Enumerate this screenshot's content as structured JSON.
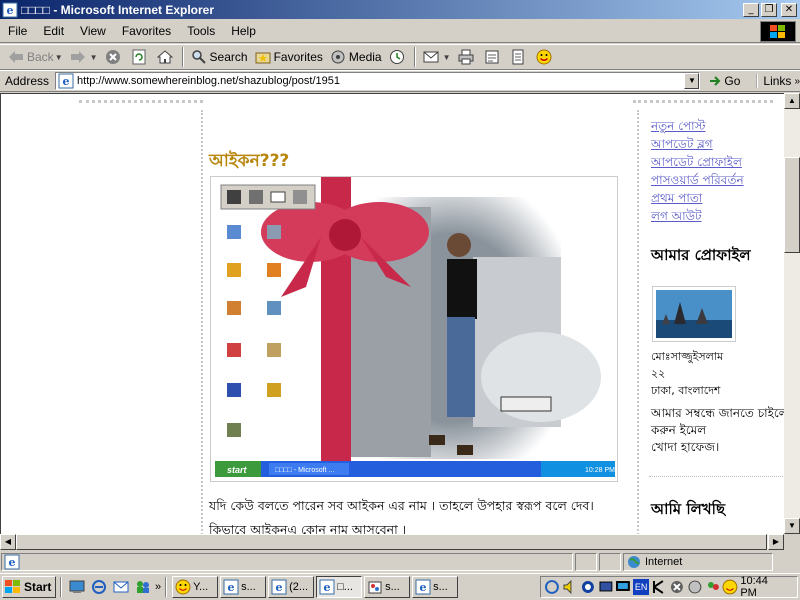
{
  "window": {
    "title": "□□□□ - Microsoft Internet Explorer",
    "minimize": "_",
    "maximize": "❐",
    "close": "✕"
  },
  "menu": [
    "File",
    "Edit",
    "View",
    "Favorites",
    "Tools",
    "Help"
  ],
  "toolbar": {
    "back": "Back",
    "search": "Search",
    "favorites": "Favorites",
    "media": "Media"
  },
  "address": {
    "label": "Address",
    "url": "http://www.somewhereinblog.net/shazublog/post/1951",
    "go": "Go",
    "links": "Links"
  },
  "post": {
    "title": "আইকন???",
    "body_line1": "যদি কেউ বলতে পারেন সব আইকন এর নাম । তাহলে উপহার স্বরূপ বলে দেব।",
    "body_line2": "কিভাবে আইকনএ কোন নাম আসবেনা ।",
    "image_taskbar_start": "start",
    "image_taskbar_task": "□□□□ - Microsoft ...",
    "image_taskbar_clock": "10:28 PM"
  },
  "sidebar": {
    "links": [
      "নতুন পোস্ট",
      "আপডেট ব্লগ",
      "আপডেট প্রোফাইল",
      "পাসওয়ার্ড পরিবর্তন",
      "প্রথম পাতা",
      "লগ আউট"
    ],
    "profile_heading": "আমার প্রোফাইল",
    "profile_name": "মোঃসাজ্জুইসলাম",
    "profile_age": "২২",
    "profile_location": "ঢাকা, বাংলাদেশ",
    "profile_about_line1": "আমার সম্বন্ধে জানতে চাইলে",
    "profile_about_line2": "করুন ইমেল",
    "profile_about_line3": "খোদা হাফেজ।",
    "writing_heading": "আমি লিখছি"
  },
  "status": {
    "zone": "Internet"
  },
  "taskbar": {
    "start": "Start",
    "tasks": [
      "Y...",
      "s...",
      "(2...",
      "□...",
      "s...",
      "s..."
    ],
    "clock": "10:44 PM",
    "quicklaunch_more": "»",
    "lang": "EN"
  },
  "colors": {
    "title_gradient_start": "#0a246a",
    "title_gradient_end": "#a6caf0",
    "post_title": "#b8860b",
    "sidebar_link": "#5a5ac8"
  }
}
